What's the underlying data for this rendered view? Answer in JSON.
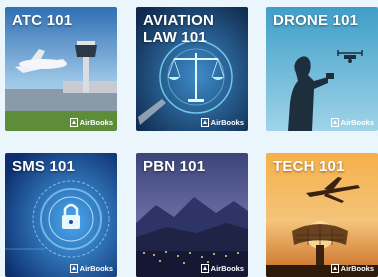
{
  "brand_name": "AirBooks",
  "courses": [
    {
      "title": "ATC 101",
      "art": "airport-tower"
    },
    {
      "title": "AVIATION LAW 101",
      "art": "scales-of-justice"
    },
    {
      "title": "DRONE 101",
      "art": "drone-pilot"
    },
    {
      "title": "SMS 101",
      "art": "security-lock"
    },
    {
      "title": "PBN 101",
      "art": "night-runway"
    },
    {
      "title": "TECH 101",
      "art": "radar-sunset"
    }
  ],
  "colors": {
    "background": "#eaf6fc",
    "atc": "#3a78b8",
    "law": "#1a3f6a",
    "drone": "#5fb6d6",
    "sms": "#1c4fa0",
    "pbn": "#4a4e86",
    "tech": "#f0a040"
  }
}
